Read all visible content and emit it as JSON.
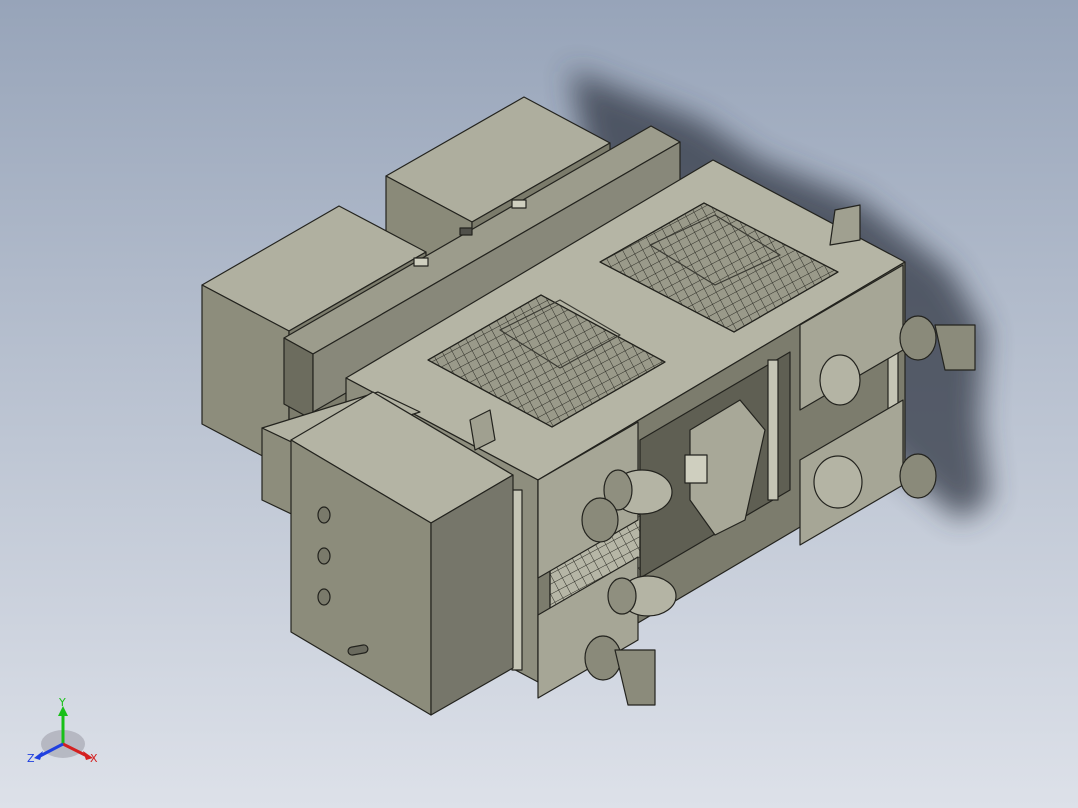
{
  "viewport": {
    "background_top": "#97a4b9",
    "background_bottom": "#dde1e9",
    "model_body_color": "#7f7f6f",
    "model_edge_color": "#2a2a24",
    "shadow_color": "#3a3f4a"
  },
  "triad": {
    "x_label": "X",
    "y_label": "Y",
    "z_label": "Z",
    "x_color": "#d42020",
    "y_color": "#18c018",
    "z_color": "#2040e0"
  }
}
